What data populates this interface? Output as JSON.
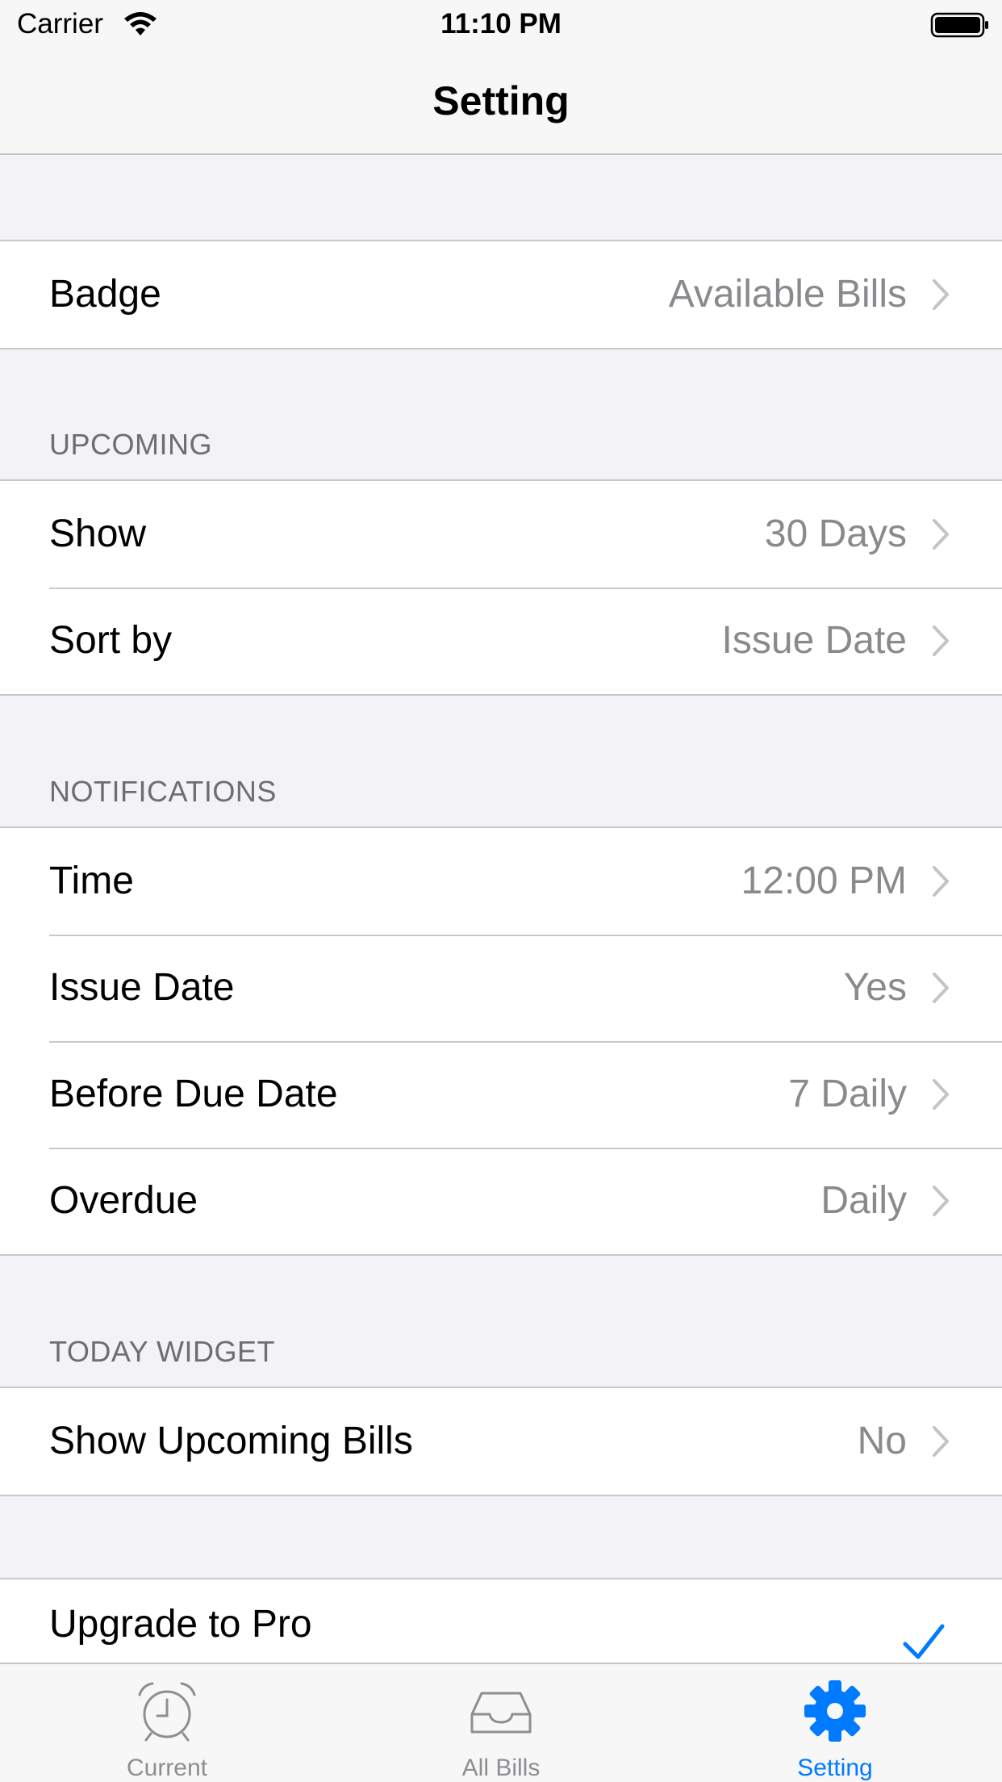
{
  "status_bar": {
    "carrier": "Carrier",
    "time": "11:10 PM"
  },
  "nav": {
    "title": "Setting"
  },
  "badge": {
    "title": "Badge",
    "value": "Available Bills"
  },
  "upcoming": {
    "header": "UPCOMING",
    "rows": [
      {
        "title": "Show",
        "value": "30 Days"
      },
      {
        "title": "Sort by",
        "value": "Issue Date"
      }
    ]
  },
  "notifications": {
    "header": "NOTIFICATIONS",
    "rows": [
      {
        "title": "Time",
        "value": "12:00 PM"
      },
      {
        "title": "Issue Date",
        "value": "Yes"
      },
      {
        "title": "Before Due Date",
        "value": "7 Daily"
      },
      {
        "title": "Overdue",
        "value": "Daily"
      }
    ]
  },
  "today_widget": {
    "header": "TODAY WIDGET",
    "rows": [
      {
        "title": "Show Upcoming Bills",
        "value": "No"
      }
    ]
  },
  "pro": {
    "title": "Upgrade to Pro",
    "selected": true
  },
  "tabs": [
    {
      "label": "Current",
      "icon": "alarm-clock-icon",
      "active": false
    },
    {
      "label": "All Bills",
      "icon": "inbox-tray-icon",
      "active": false
    },
    {
      "label": "Setting",
      "icon": "gear-icon",
      "active": true
    }
  ],
  "colors": {
    "accent": "#007aff",
    "secondary_text": "#8a8a8e",
    "background": "#f2f2f7",
    "separator": "#c8c7cc"
  }
}
